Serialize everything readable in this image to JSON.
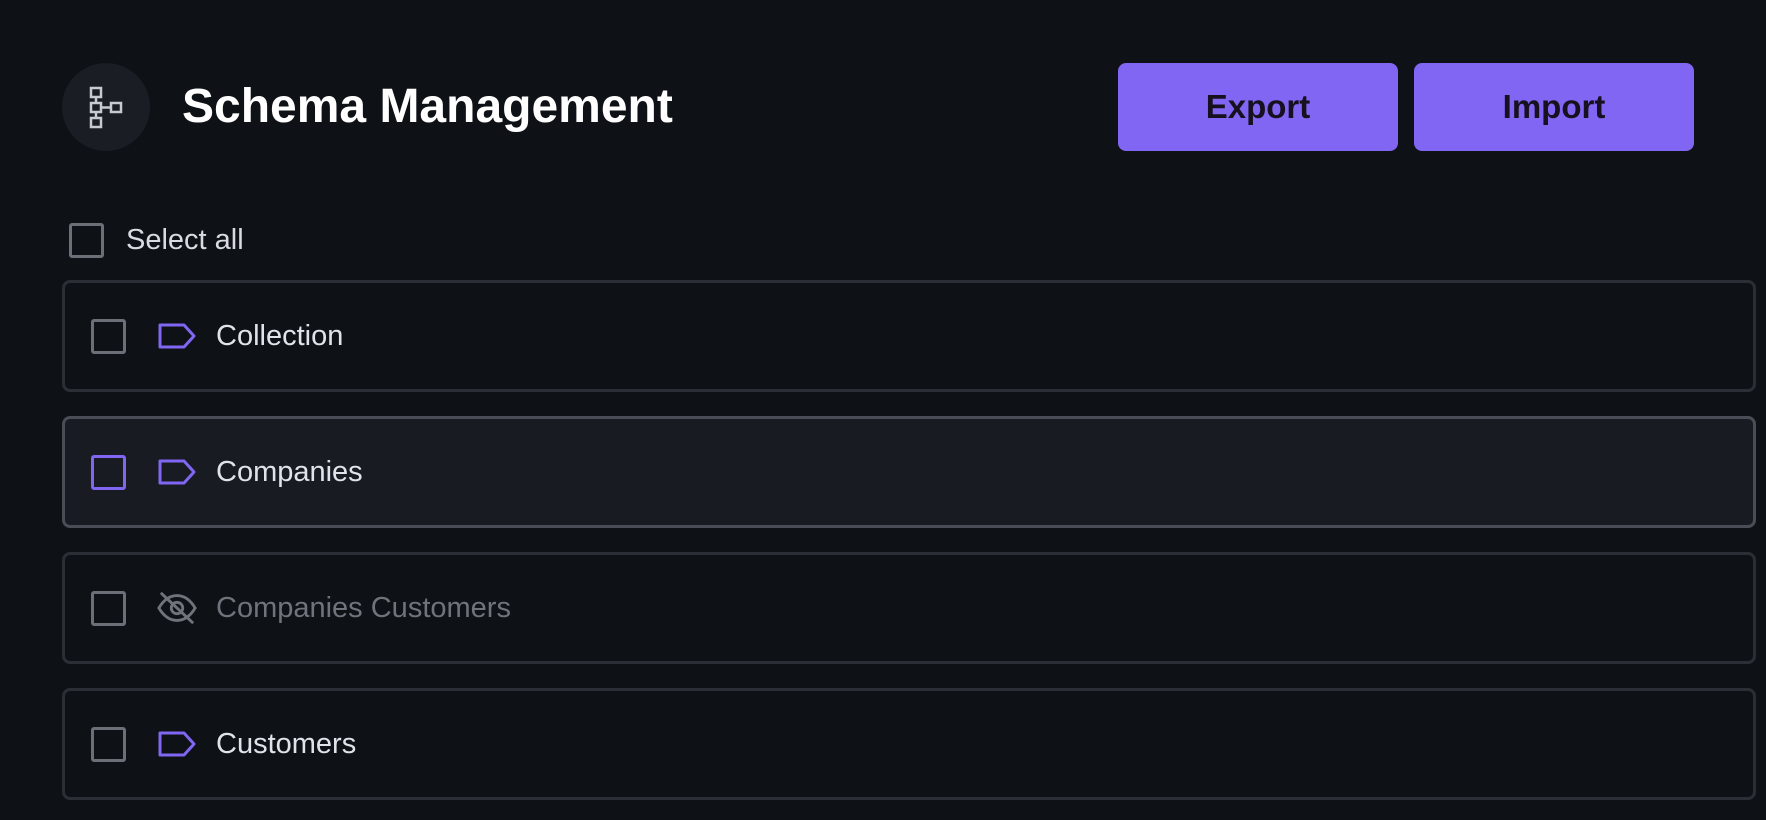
{
  "header": {
    "title": "Schema Management",
    "icon": "schema-tree-icon",
    "export_label": "Export",
    "import_label": "Import"
  },
  "select_all": {
    "label": "Select all",
    "checked": false
  },
  "items": [
    {
      "label": "Collection",
      "icon": "tag-icon",
      "visible": true,
      "checked": false
    },
    {
      "label": "Companies",
      "icon": "tag-icon",
      "visible": true,
      "checked": false,
      "hovered": true
    },
    {
      "label": "Companies Customers",
      "icon": "eye-off-icon",
      "visible": false,
      "checked": false
    },
    {
      "label": "Customers",
      "icon": "tag-icon",
      "visible": true,
      "checked": false
    }
  ],
  "colors": {
    "background": "#0e1116",
    "accent": "#8066f2",
    "row_border": "#2b2e35",
    "muted_text": "#6f737b"
  }
}
